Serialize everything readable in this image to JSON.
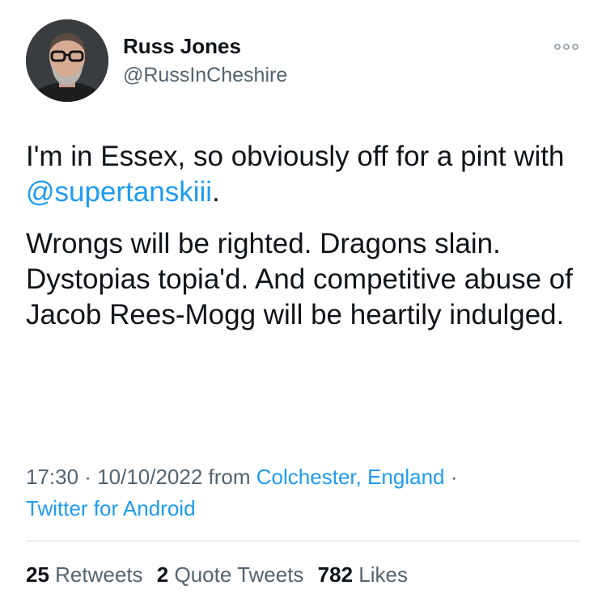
{
  "author": {
    "name": "Russ Jones",
    "handle": "@RussInCheshire"
  },
  "tweet": {
    "para1_text": "I'm in Essex, so obviously off for a pint with ",
    "para1_mention": "@supertanskiii",
    "para1_end": ".",
    "para2": "Wrongs will be righted. Dragons slain. Dystopias topia'd. And competitive abuse of Jacob Rees-Mogg will be heartily indulged."
  },
  "meta": {
    "time": "17:30",
    "sep1": " · ",
    "date": "10/10/2022",
    "from_label": " from ",
    "location": "Colchester, England",
    "sep2": " ·",
    "client": "Twitter for Android"
  },
  "stats": {
    "retweets_count": "25",
    "retweets_label": "Retweets",
    "quotes_count": "2",
    "quotes_label": "Quote Tweets",
    "likes_count": "782",
    "likes_label": "Likes"
  },
  "icons": {
    "more": "more-horizontal-icon"
  },
  "colors": {
    "link": "#1d9bf0",
    "secondary_text": "#536471",
    "primary_text": "#0f1419",
    "divider": "#cfd9de"
  }
}
